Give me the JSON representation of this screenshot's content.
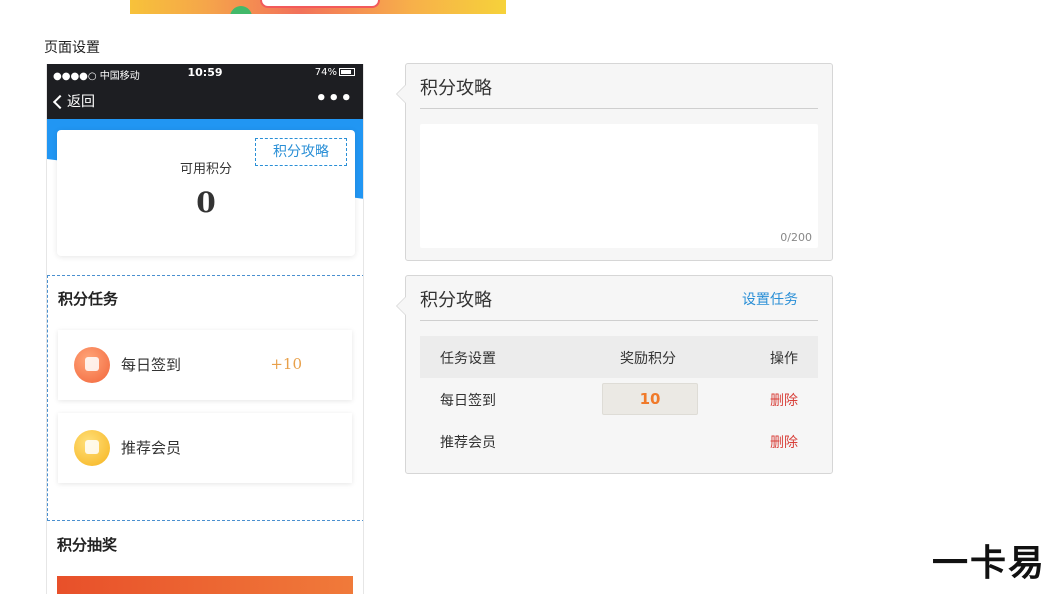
{
  "page_label": "页面设置",
  "status_bar": {
    "carrier": "●●●●○ 中国移动",
    "time": "10:59",
    "battery": "74%"
  },
  "nav": {
    "back_label": "返回",
    "more": "•••"
  },
  "points_card": {
    "guide_button": "积分攻略",
    "label": "可用积分",
    "value": "0"
  },
  "tasks_section": {
    "title": "积分任务",
    "items": [
      {
        "name": "每日签到",
        "reward": "+10"
      },
      {
        "name": "推荐会员",
        "reward": ""
      }
    ]
  },
  "lottery_section": {
    "title": "积分抽奖"
  },
  "guide_panel": {
    "title": "积分攻略",
    "char_count": "0/200"
  },
  "task_panel": {
    "title": "积分攻略",
    "set_task_link": "设置任务",
    "headers": [
      "任务设置",
      "奖励积分",
      "操作"
    ],
    "rows": [
      {
        "name": "每日签到",
        "reward": "10",
        "action": "删除"
      },
      {
        "name": "推荐会员",
        "reward": "",
        "action": "删除"
      }
    ]
  },
  "brand": "一卡易",
  "colors": {
    "accent_blue": "#2196f3",
    "link_blue": "#2a8fd6",
    "danger_red": "#d8403a",
    "reward_orange": "#f07a2a"
  }
}
